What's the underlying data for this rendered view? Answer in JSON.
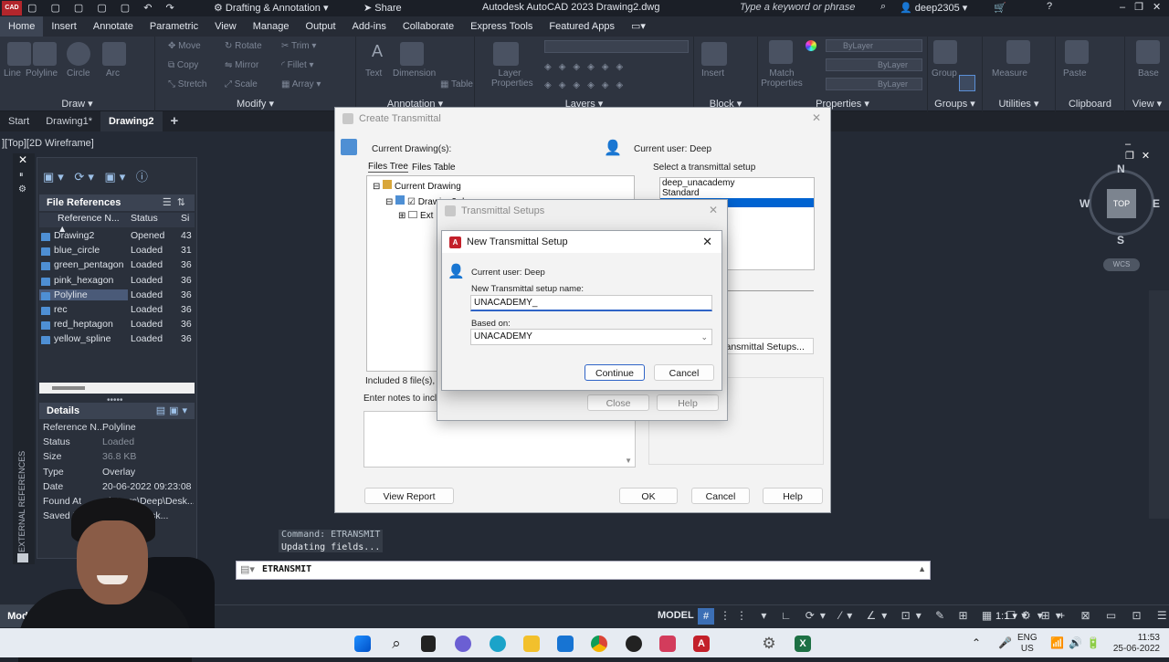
{
  "titlebar": {
    "app_logo": "CAD",
    "workspace": "Drafting & Annotation",
    "share": "Share",
    "title": "Autodesk AutoCAD 2023   Drawing2.dwg",
    "search_placeholder": "Type a keyword or phrase",
    "user": "deep2305"
  },
  "menu": [
    "Home",
    "Insert",
    "Annotate",
    "Parametric",
    "View",
    "Manage",
    "Output",
    "Add-ins",
    "Collaborate",
    "Express Tools",
    "Featured Apps"
  ],
  "ribbon": {
    "draw": {
      "title": "Draw",
      "tools": [
        "Line",
        "Polyline",
        "Circle",
        "Arc"
      ]
    },
    "modify": {
      "title": "Modify",
      "tools": [
        "Move",
        "Rotate",
        "Trim",
        "Copy",
        "Mirror",
        "Fillet",
        "Stretch",
        "Scale",
        "Array"
      ]
    },
    "annotation": {
      "title": "Annotation",
      "tools": [
        "Text",
        "Dimension",
        "Table"
      ]
    },
    "layers": {
      "title": "Layers",
      "tools": [
        "Layer Properties"
      ]
    },
    "block": {
      "title": "Block",
      "tools": [
        "Insert"
      ]
    },
    "properties": {
      "title": "Properties",
      "tools": [
        "Match Properties",
        "ByLayer",
        "ByLayer",
        "ByLayer"
      ]
    },
    "groups": {
      "title": "Groups",
      "tools": [
        "Group"
      ]
    },
    "utilities": {
      "title": "Utilities",
      "tools": [
        "Measure"
      ]
    },
    "clipboard": {
      "title": "Clipboard",
      "tools": [
        "Paste"
      ]
    },
    "view": {
      "title": "View",
      "tools": [
        "Base"
      ]
    }
  },
  "file_tabs": [
    "Start",
    "Drawing1*",
    "Drawing2"
  ],
  "viewport_label": "][Top][2D Wireframe]",
  "viewcube": {
    "n": "N",
    "s": "S",
    "w": "W",
    "e": "E",
    "top": "TOP",
    "wcs": "WCS"
  },
  "xref_palette": {
    "side_label": "EXTERNAL REFERENCES",
    "file_refs_title": "File References",
    "columns": [
      "Reference N...",
      "Status",
      "Si"
    ],
    "rows": [
      {
        "name": "Drawing2",
        "status": "Opened",
        "size": "43"
      },
      {
        "name": "blue_circle",
        "status": "Loaded",
        "size": "31"
      },
      {
        "name": "green_pentagon",
        "status": "Loaded",
        "size": "36"
      },
      {
        "name": "pink_hexagon",
        "status": "Loaded",
        "size": "36"
      },
      {
        "name": "Polyline",
        "status": "Loaded",
        "size": "36"
      },
      {
        "name": "rec",
        "status": "Loaded",
        "size": "36"
      },
      {
        "name": "red_heptagon",
        "status": "Loaded",
        "size": "36"
      },
      {
        "name": "yellow_spline",
        "status": "Loaded",
        "size": "36"
      }
    ],
    "details_title": "Details",
    "details": [
      {
        "k": "Reference N...",
        "v": "Polyline"
      },
      {
        "k": "Status",
        "v": "Loaded"
      },
      {
        "k": "Size",
        "v": "36.8 KB"
      },
      {
        "k": "Type",
        "v": "Overlay"
      },
      {
        "k": "Date",
        "v": "20-06-2022 09:23:08"
      },
      {
        "k": "Found At",
        "v": "...\\Users\\Deep\\Desk..."
      },
      {
        "k": "Saved P...",
        "v": "...\\Deep\\Desk..."
      }
    ]
  },
  "create_transmittal": {
    "title": "Create Transmittal",
    "current_drawings": "Current Drawing(s):",
    "current_user": "Current user: Deep",
    "tab_files_tree": "Files Tree",
    "tab_files_table": "Files Table",
    "tree_root": "Current Drawing",
    "tree_child": "Drawing2.dwg",
    "tree_child2": "Ext",
    "included": "Included 8 file(s), 30",
    "notes_label": "Enter notes to includ",
    "select_setup": "Select a transmittal setup",
    "setups": [
      "deep_unacademy",
      "Standard"
    ],
    "setups_button": "ransmittal Setups...",
    "view_report": "View Report",
    "ok": "OK",
    "cancel": "Cancel",
    "help": "Help"
  },
  "transmittal_setups": {
    "title": "Transmittal Setups",
    "close": "Close",
    "help": "Help"
  },
  "new_setup": {
    "title": "New Transmittal Setup",
    "current_user": "Current user: Deep",
    "name_label": "New Transmittal setup name:",
    "name_value": "UNACADEMY_",
    "based_on_label": "Based on:",
    "based_on_value": "UNACADEMY",
    "continue": "Continue",
    "cancel": "Cancel"
  },
  "command": {
    "history1": "Command: ETRANSMIT",
    "history2": "Updating fields...",
    "current": "ETRANSMIT"
  },
  "status": {
    "model_tab": "Model",
    "model": "MODEL",
    "scale": "1:1"
  },
  "taskbar": {
    "lang": "ENG",
    "region": "US",
    "time": "11:53",
    "date": "25-06-2022"
  }
}
